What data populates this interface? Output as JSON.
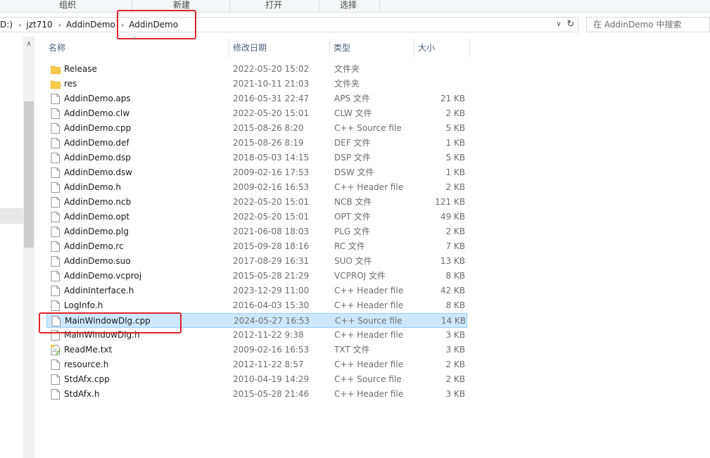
{
  "ribbon": {
    "groups": [
      "组织",
      "新建",
      "打开",
      "选择"
    ]
  },
  "address": {
    "crumbs": [
      "D:)",
      "jzt710",
      "AddinDemo",
      "AddinDemo"
    ],
    "search_placeholder": "在 AddinDemo 中搜索"
  },
  "columns": {
    "name": "名称",
    "date": "修改日期",
    "type": "类型",
    "size": "大小"
  },
  "files": [
    {
      "name": "Release",
      "date": "2022-05-20 15:02",
      "type": "文件夹",
      "size": "",
      "icon": "folder-icon"
    },
    {
      "name": "res",
      "date": "2021-10-11 21:03",
      "type": "文件夹",
      "size": "",
      "icon": "folder-icon"
    },
    {
      "name": "AddinDemo.aps",
      "date": "2016-05-31 22:47",
      "type": "APS 文件",
      "size": "21 KB",
      "icon": "file-icon"
    },
    {
      "name": "AddinDemo.clw",
      "date": "2022-05-20 15:01",
      "type": "CLW 文件",
      "size": "2 KB",
      "icon": "file-icon"
    },
    {
      "name": "AddinDemo.cpp",
      "date": "2015-08-26 8:20",
      "type": "C++ Source file",
      "size": "5 KB",
      "icon": "file-icon"
    },
    {
      "name": "AddinDemo.def",
      "date": "2015-08-26 8:19",
      "type": "DEF 文件",
      "size": "1 KB",
      "icon": "file-icon"
    },
    {
      "name": "AddinDemo.dsp",
      "date": "2018-05-03 14:15",
      "type": "DSP 文件",
      "size": "5 KB",
      "icon": "file-icon"
    },
    {
      "name": "AddinDemo.dsw",
      "date": "2009-02-16 17:53",
      "type": "DSW 文件",
      "size": "1 KB",
      "icon": "file-icon"
    },
    {
      "name": "AddinDemo.h",
      "date": "2009-02-16 16:53",
      "type": "C++ Header file",
      "size": "2 KB",
      "icon": "file-icon"
    },
    {
      "name": "AddinDemo.ncb",
      "date": "2022-05-20 15:01",
      "type": "NCB 文件",
      "size": "121 KB",
      "icon": "file-icon"
    },
    {
      "name": "AddinDemo.opt",
      "date": "2022-05-20 15:01",
      "type": "OPT 文件",
      "size": "49 KB",
      "icon": "file-icon"
    },
    {
      "name": "AddinDemo.plg",
      "date": "2021-06-08 18:03",
      "type": "PLG 文件",
      "size": "2 KB",
      "icon": "file-icon"
    },
    {
      "name": "AddinDemo.rc",
      "date": "2015-09-28 18:16",
      "type": "RC 文件",
      "size": "7 KB",
      "icon": "file-icon"
    },
    {
      "name": "AddinDemo.suo",
      "date": "2017-08-29 16:31",
      "type": "SUO 文件",
      "size": "13 KB",
      "icon": "file-icon"
    },
    {
      "name": "AddinDemo.vcproj",
      "date": "2015-05-28 21:29",
      "type": "VCPROJ 文件",
      "size": "8 KB",
      "icon": "file-icon"
    },
    {
      "name": "AddinInterface.h",
      "date": "2023-12-29 11:00",
      "type": "C++ Header file",
      "size": "42 KB",
      "icon": "file-icon"
    },
    {
      "name": "LogInfo.h",
      "date": "2016-04-03 15:30",
      "type": "C++ Header file",
      "size": "8 KB",
      "icon": "file-icon"
    },
    {
      "name": "MainWindowDlg.cpp",
      "date": "2024-05-27 16:53",
      "type": "C++ Source file",
      "size": "14 KB",
      "icon": "file-icon",
      "selected": true
    },
    {
      "name": "MainWindowDlg.h",
      "date": "2012-11-22 9:38",
      "type": "C++ Header file",
      "size": "3 KB",
      "icon": "file-icon"
    },
    {
      "name": "ReadMe.txt",
      "date": "2009-02-16 16:53",
      "type": "TXT 文件",
      "size": "3 KB",
      "icon": "text-file-icon"
    },
    {
      "name": "resource.h",
      "date": "2012-11-22 8:57",
      "type": "C++ Header file",
      "size": "2 KB",
      "icon": "file-icon"
    },
    {
      "name": "StdAfx.cpp",
      "date": "2010-04-19 14:29",
      "type": "C++ Source file",
      "size": "2 KB",
      "icon": "file-icon"
    },
    {
      "name": "StdAfx.h",
      "date": "2015-05-28 21:46",
      "type": "C++ Header file",
      "size": "3 KB",
      "icon": "file-icon"
    }
  ],
  "colors": {
    "selection_bg": "#cce8ff",
    "selection_border": "#99d1ff",
    "highlight_box": "#e0242d",
    "folder": "#f7ca4a"
  }
}
